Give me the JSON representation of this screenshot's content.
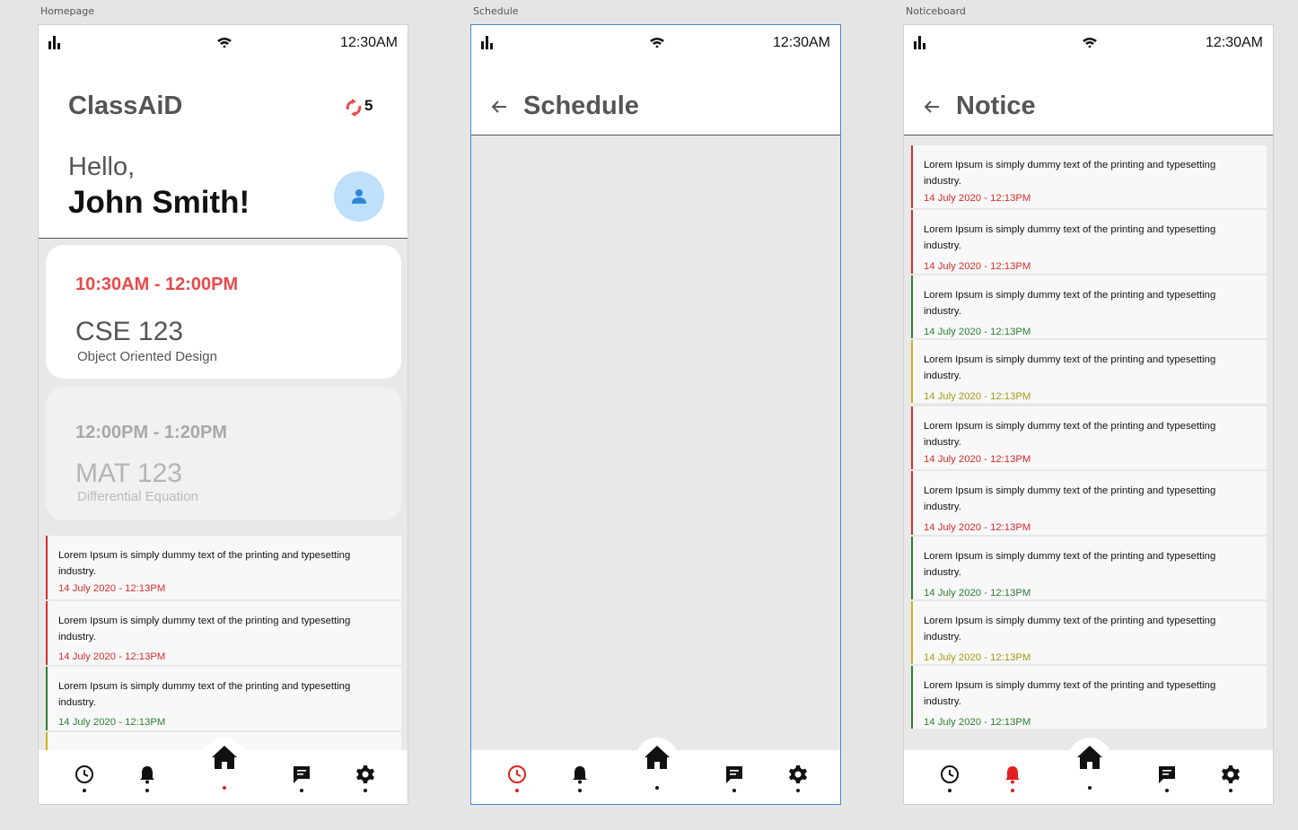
{
  "artboards": {
    "homepage_label": "Homepage",
    "schedule_label": "Schedule",
    "noticeboard_label": "Noticeboard"
  },
  "status": {
    "time": "12:30AM"
  },
  "home": {
    "brand": "ClassAiD",
    "refresh_count": "5",
    "greeting": "Hello,",
    "user_name": "John Smith!",
    "classes": [
      {
        "time": "10:30AM - 12:00PM",
        "code": "CSE 123",
        "name": "Object Oriented Design"
      },
      {
        "time": "12:00PM - 1:20PM",
        "code": "MAT 123",
        "name": "Differential Equation"
      }
    ]
  },
  "schedule": {
    "title": "Schedule"
  },
  "noticeboard": {
    "title": "Notice"
  },
  "notices": [
    {
      "text": "Lorem Ipsum is simply dummy text of the printing and typesetting industry.",
      "date": "14 July 2020 - 12:13PM",
      "status": "red"
    },
    {
      "text": "Lorem Ipsum is simply dummy text of the printing and typesetting industry.",
      "date": "14 July 2020 - 12:13PM",
      "status": "red"
    },
    {
      "text": "Lorem Ipsum is simply dummy text of the printing and typesetting industry.",
      "date": "14 July 2020 - 12:13PM",
      "status": "green"
    },
    {
      "text": "Lorem Ipsum is simply dummy text of the printing and typesetting industry.",
      "date": "14 July 2020 - 12:13PM",
      "status": "yellow"
    },
    {
      "text": "Lorem Ipsum is simply dummy text of the printing and typesetting industry.",
      "date": "14 July 2020 - 12:13PM",
      "status": "red"
    },
    {
      "text": "Lorem Ipsum is simply dummy text of the printing and typesetting industry.",
      "date": "14 July 2020 - 12:13PM",
      "status": "red"
    },
    {
      "text": "Lorem Ipsum is simply dummy text of the printing and typesetting industry.",
      "date": "14 July 2020 - 12:13PM",
      "status": "green"
    },
    {
      "text": "Lorem Ipsum is simply dummy text of the printing and typesetting industry.",
      "date": "14 July 2020 - 12:13PM",
      "status": "yellow"
    },
    {
      "text": "Lorem Ipsum is simply dummy text of the printing and typesetting industry.",
      "date": "14 July 2020 - 12:13PM",
      "status": "green"
    }
  ],
  "nav": {
    "icons": [
      "clock-icon",
      "bell-icon",
      "home-icon",
      "chat-icon",
      "gear-icon"
    ],
    "active_color": "#e02020",
    "inactive_color": "#111111"
  },
  "colors": {
    "accent_red": "#e84a4a",
    "status_red": "#d82c2c",
    "status_green": "#2e7d32",
    "status_yellow": "#a39a12",
    "avatar_bg": "#bfe0fb"
  }
}
